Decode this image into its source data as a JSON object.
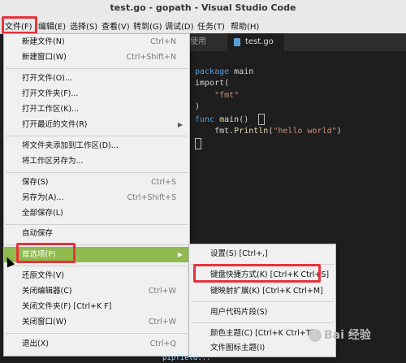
{
  "window": {
    "title": "test.go - gopath - Visual Studio Code"
  },
  "menubar": [
    "文件(F)",
    "编辑(E)",
    "选择(S)",
    "查看(V)",
    "转到(G)",
    "调试(D)",
    "任务(T)",
    "帮助(H)"
  ],
  "editor": {
    "tab_prev": "使用",
    "tab_active": "test.go",
    "code": {
      "l1_kw": "package",
      "l1_rest": " main",
      "l2": "import(",
      "l3": "\"fmt\"",
      "l4": ")",
      "l5_kw": "func",
      "l5_fn": " main",
      "l5_rest": "()  ",
      "l6_a": "fmt.",
      "l6_fn": "Println",
      "l6_b": "(",
      "l6_str": "\"hello world\"",
      "l6_c": ")"
    }
  },
  "file_menu": {
    "new_file": "新建文件(N)",
    "new_file_sc": "Ctrl+N",
    "new_window": "新建窗口(W)",
    "new_window_sc": "Ctrl+Shift+N",
    "open_file": "打开文件(O)...",
    "open_folder": "打开文件夹(F)...",
    "open_workspace": "打开工作区(K)...",
    "open_recent": "打开最近的文件(R)",
    "add_folder": "将文件夹添加到工作区(D)...",
    "save_workspace_as": "将工作区另存为...",
    "save": "保存(S)",
    "save_sc": "Ctrl+S",
    "save_as": "另存为(A)...",
    "save_as_sc": "Ctrl+Shift+S",
    "save_all": "全部保存(L)",
    "auto_save": "自动保存",
    "preferences": "首选项(P)",
    "revert": "还原文件(V)",
    "close_editor": "关闭编辑器(C)",
    "close_editor_sc": "Ctrl+W",
    "close_folder": "关闭文件夹(F) [Ctrl+K F]",
    "close_window": "关闭窗口(W)",
    "close_window_sc": "Ctrl+W",
    "exit": "退出(X)",
    "exit_sc": "Ctrl+Q"
  },
  "pref_menu": {
    "settings": "设置(S) [Ctrl+,]",
    "keyboard_shortcuts": "键盘快捷方式(K) [Ctrl+K Ctrl+S]",
    "keymaps": "键映射扩展(K) [Ctrl+K Ctrl+M]",
    "user_snippets": "用户代码片段(S)",
    "color_theme": "颜色主题(C) [Ctrl+K Ctrl+T]",
    "icon_theme": "文件图标主题(I)"
  },
  "watermark": {
    "text": "Bai 经验"
  },
  "bottom_code": "pipfield..."
}
